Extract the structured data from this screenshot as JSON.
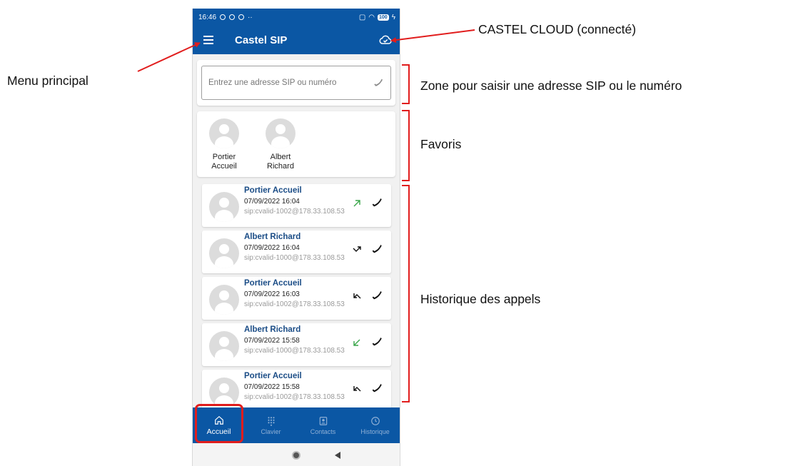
{
  "status_bar": {
    "time": "16:46",
    "battery": "100"
  },
  "app_bar": {
    "title": "Castel SIP"
  },
  "search": {
    "placeholder": "Entrez une adresse SIP ou numéro"
  },
  "favorites": [
    {
      "name_line1": "Portier",
      "name_line2": "Accueil"
    },
    {
      "name_line1": "Albert",
      "name_line2": "Richard"
    }
  ],
  "calls": [
    {
      "name": "Portier Accueil",
      "datetime": "07/09/2022 16:04",
      "sip": "sip:cvalid-1002@178.33.108.53",
      "direction": "outgoing"
    },
    {
      "name": "Albert Richard",
      "datetime": "07/09/2022 16:04",
      "sip": "sip:cvalid-1000@178.33.108.53",
      "direction": "outgoing-missed"
    },
    {
      "name": "Portier Accueil",
      "datetime": "07/09/2022 16:03",
      "sip": "sip:cvalid-1002@178.33.108.53",
      "direction": "incoming-missed"
    },
    {
      "name": "Albert Richard",
      "datetime": "07/09/2022 15:58",
      "sip": "sip:cvalid-1000@178.33.108.53",
      "direction": "incoming"
    },
    {
      "name": "Portier Accueil",
      "datetime": "07/09/2022 15:58",
      "sip": "sip:cvalid-1002@178.33.108.53",
      "direction": "incoming-missed"
    }
  ],
  "bottom_nav": [
    {
      "label": "Accueil",
      "icon": "home-icon",
      "active": true
    },
    {
      "label": "Clavier",
      "icon": "dialpad-icon",
      "active": false
    },
    {
      "label": "Contacts",
      "icon": "contacts-icon",
      "active": false
    },
    {
      "label": "Historique",
      "icon": "clock-icon",
      "active": false
    }
  ],
  "annotations": {
    "cloud": "CASTEL CLOUD (connecté)",
    "menu": "Menu principal",
    "search_zone": "Zone pour saisir une adresse SIP ou le numéro",
    "favorites": "Favoris",
    "history": "Historique des appels"
  },
  "colors": {
    "primary": "#0b57a4",
    "annotation": "#e11d1d",
    "outgoing": "#3aa64a",
    "contact_name": "#1a4c86"
  }
}
